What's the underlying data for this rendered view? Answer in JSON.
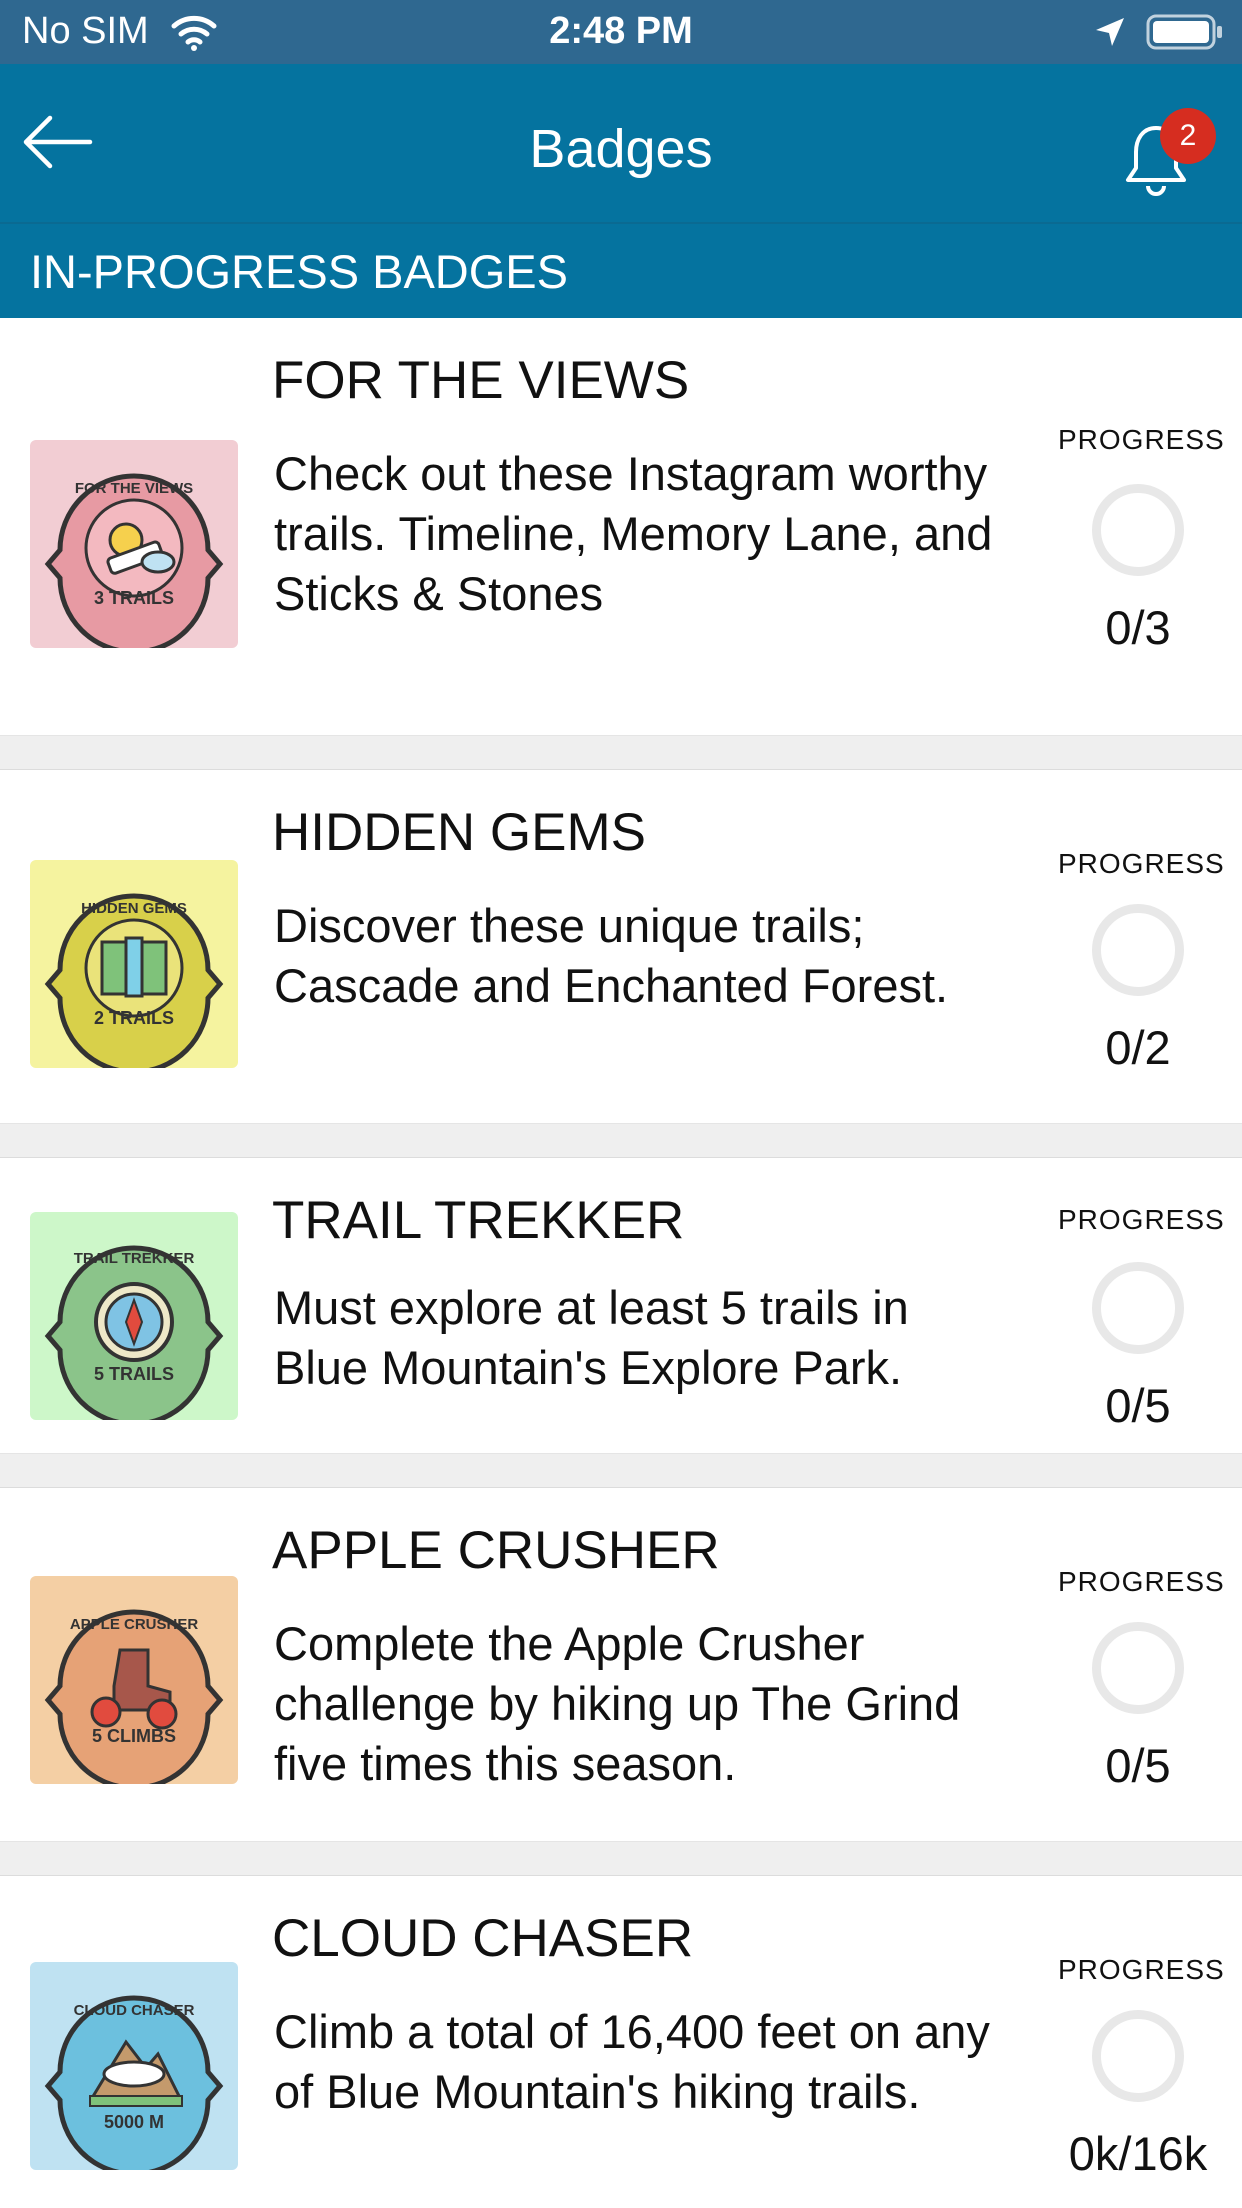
{
  "status_bar": {
    "carrier": "No SIM",
    "time": "2:48 PM"
  },
  "nav": {
    "title": "Badges",
    "notification_count": "2"
  },
  "section": {
    "title": "IN-PROGRESS BADGES"
  },
  "progress_label": "PROGRESS",
  "colors": {
    "status_bar": "#2f6890",
    "nav": "#05739f",
    "notification_badge": "#d62d20",
    "separator": "#efefef"
  },
  "badges": [
    {
      "title": "FOR THE VIEWS",
      "description": "Check out these Instagram worthy trails. Timeline, Memory Lane, and Sticks & Stones",
      "progress": "0/3",
      "progress_fraction": 0,
      "patch_label": "3 TRAILS",
      "patch_top": "FOR THE VIEWS",
      "thumb_bg": "#f2cdd3",
      "patch_color": "#e79aa3"
    },
    {
      "title": "HIDDEN GEMS",
      "description": "Discover these unique trails; Cascade and Enchanted Forest.",
      "progress": "0/2",
      "progress_fraction": 0,
      "patch_label": "2 TRAILS",
      "patch_top": "HIDDEN GEMS",
      "thumb_bg": "#f5f39f",
      "patch_color": "#d8d04a"
    },
    {
      "title": "TRAIL TREKKER",
      "description": "Must explore at least 5 trails in Blue Mountain's Explore Park.",
      "progress": "0/5",
      "progress_fraction": 0,
      "patch_label": "5 TRAILS",
      "patch_top": "TRAIL TREKKER",
      "thumb_bg": "#cdf7c9",
      "patch_color": "#8bc48a"
    },
    {
      "title": "APPLE CRUSHER",
      "description": "Complete the Apple Crusher challenge by hiking up The Grind five times this season.",
      "progress": "0/5",
      "progress_fraction": 0,
      "patch_label": "5 CLIMBS",
      "patch_top": "APPLE CRUSHER",
      "thumb_bg": "#f4cfa4",
      "patch_color": "#e6a276"
    },
    {
      "title": "CLOUD CHASER",
      "description": "Climb a total of 16,400 feet on any of Blue Mountain's hiking trails.",
      "progress": "0k/16k",
      "progress_fraction": 0,
      "patch_label": "5000 M",
      "patch_top": "CLOUD CHASER",
      "thumb_bg": "#bfe2f2",
      "patch_color": "#6cc0de"
    }
  ]
}
